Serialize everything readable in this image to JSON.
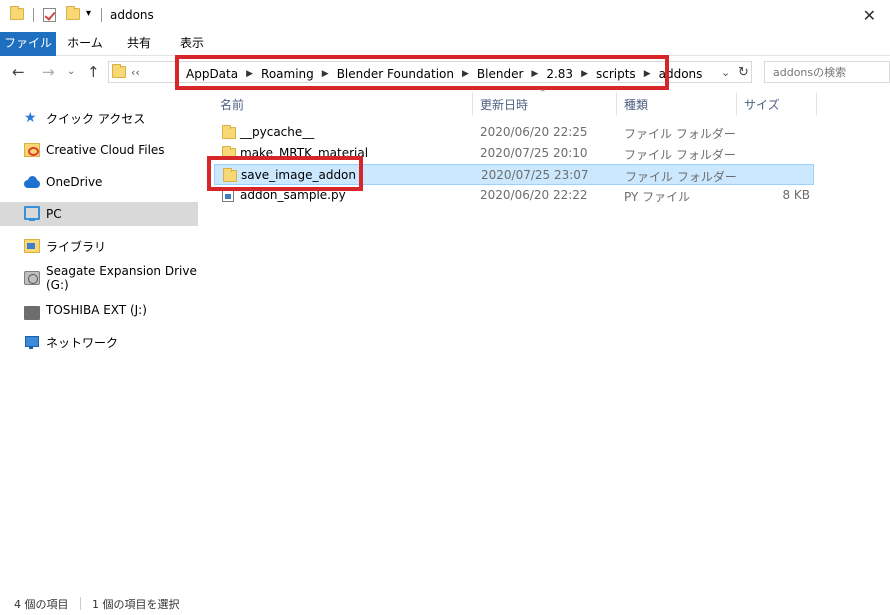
{
  "window": {
    "title": "addons",
    "close_glyph": "✕"
  },
  "ribbon": {
    "tabs": [
      "ファイル",
      "ホーム",
      "共有",
      "表示"
    ]
  },
  "address": {
    "overflow": "‹‹",
    "crumbs": [
      "AppData",
      "Roaming",
      "Blender Foundation",
      "Blender",
      "2.83",
      "scripts",
      "addons"
    ],
    "search_placeholder": "addonsの検索"
  },
  "sidebar": {
    "items": [
      {
        "label": "クイック アクセス",
        "icon": "star-icon"
      },
      {
        "label": "Creative Cloud Files",
        "icon": "creative-cloud-icon"
      },
      {
        "label": "OneDrive",
        "icon": "onedrive-icon"
      },
      {
        "label": "PC",
        "icon": "pc-icon"
      },
      {
        "label": "ライブラリ",
        "icon": "library-icon"
      },
      {
        "label": "Seagate Expansion Drive (G:)",
        "icon": "drive-icon"
      },
      {
        "label": "TOSHIBA EXT (J:)",
        "icon": "usb-drive-icon"
      },
      {
        "label": "ネットワーク",
        "icon": "network-icon"
      }
    ]
  },
  "columns": {
    "name": "名前",
    "date": "更新日時",
    "type": "種類",
    "size": "サイズ"
  },
  "files": [
    {
      "name": "__pycache__",
      "date": "2020/06/20 22:25",
      "type": "ファイル フォルダー",
      "size": "",
      "icon": "folder-icon"
    },
    {
      "name": "make_MRTK_material",
      "date": "2020/07/25 20:10",
      "type": "ファイル フォルダー",
      "size": "",
      "icon": "folder-icon"
    },
    {
      "name": "save_image_addon",
      "date": "2020/07/25 23:07",
      "type": "ファイル フォルダー",
      "size": "",
      "icon": "folder-icon"
    },
    {
      "name": "addon_sample.py",
      "date": "2020/06/20 22:22",
      "type": "PY ファイル",
      "size": "8 KB",
      "icon": "python-file-icon"
    }
  ],
  "status": {
    "count": "4 個の項目",
    "selected": "1 個の項目を選択"
  },
  "colors": {
    "accent": "#1e6fbf",
    "highlight": "#d7262a",
    "selection": "#cce8ff"
  }
}
